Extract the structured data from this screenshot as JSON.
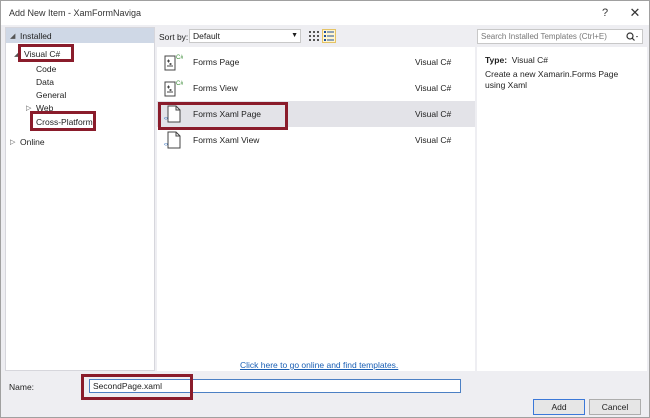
{
  "window": {
    "title": "Add New Item - XamFormNaviga",
    "help": "?",
    "close": "✕"
  },
  "tree": {
    "installed": "Installed",
    "visual_csharp": "Visual C#",
    "code": "Code",
    "data": "Data",
    "general": "General",
    "web": "Web",
    "cross_platform": "Cross-Platform",
    "online": "Online"
  },
  "sort": {
    "label": "Sort by:",
    "value": "Default"
  },
  "search": {
    "placeholder": "Search Installed Templates (Ctrl+E)"
  },
  "templates": [
    {
      "name": "Forms Page",
      "lang": "Visual C#",
      "icon": "forms-cs-icon"
    },
    {
      "name": "Forms View",
      "lang": "Visual C#",
      "icon": "forms-cs-icon"
    },
    {
      "name": "Forms Xaml Page",
      "lang": "Visual C#",
      "icon": "xaml-page-icon",
      "selected": true
    },
    {
      "name": "Forms Xaml View",
      "lang": "Visual C#",
      "icon": "xaml-page-icon"
    }
  ],
  "online_link": "Click here to go online and find templates.",
  "details": {
    "type_label": "Type:",
    "type_value": "Visual C#",
    "description": "Create a new Xamarin.Forms Page using Xaml"
  },
  "name_field": {
    "label": "Name:",
    "value": "SecondPage.xaml"
  },
  "buttons": {
    "add": "Add",
    "cancel": "Cancel"
  },
  "colors": {
    "highlight_box": "#8a1c2b",
    "link": "#1a5fb4",
    "selected_row": "#e3e3e8"
  }
}
